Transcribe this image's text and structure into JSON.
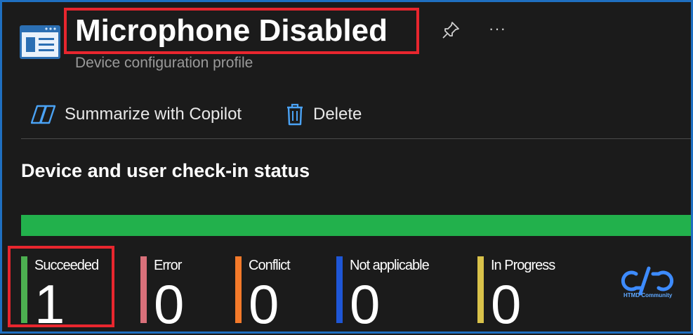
{
  "header": {
    "title": "Microphone Disabled",
    "subtitle": "Device configuration profile",
    "more_label": "···"
  },
  "toolbar": {
    "copilot_label": "Summarize with Copilot",
    "delete_label": "Delete"
  },
  "status": {
    "section_title": "Device and user check-in status",
    "progress_fraction": 1.0,
    "stats": [
      {
        "label": "Succeeded",
        "value": "1",
        "color": "#4caf50"
      },
      {
        "label": "Error",
        "value": "0",
        "color": "#d9707a"
      },
      {
        "label": "Conflict",
        "value": "0",
        "color": "#f47a2a"
      },
      {
        "label": "Not applicable",
        "value": "0",
        "color": "#1e56d6"
      },
      {
        "label": "In Progress",
        "value": "0",
        "color": "#d9c24a"
      }
    ]
  },
  "watermark": {
    "text": "HTMD Community"
  },
  "colors": {
    "accent_border": "#1f6fc0",
    "highlight": "#e8262e",
    "progress_success": "#22b14c"
  }
}
